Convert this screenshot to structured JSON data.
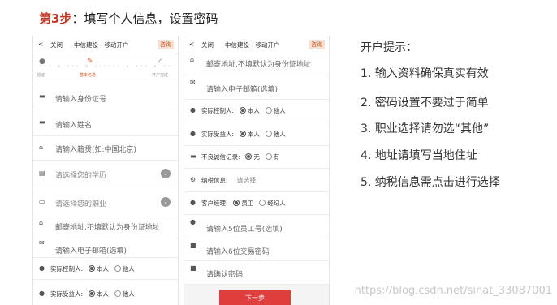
{
  "step_title": {
    "prefix": "第3步",
    "rest": "：填写个人信息，设置密码"
  },
  "phone1": {
    "topbar": {
      "back_icon": "chevron-left-icon",
      "close": "关闭",
      "title": "中信建投 - 移动开户",
      "badge": "咨询"
    },
    "steps": {
      "first": "验证",
      "active": "基本信息",
      "last": "开户完成"
    },
    "rows": [
      {
        "icon": "id-card-icon",
        "text": "请输入身份证号"
      },
      {
        "icon": "id-card-icon",
        "text": "请输入姓名"
      },
      {
        "icon": "home-icon",
        "text": "请输入籍贯(如:中国北京)"
      },
      {
        "icon": "book-icon",
        "text": "请选择您的学历"
      },
      {
        "icon": "briefcase-icon",
        "text": "请选择您的职业"
      },
      {
        "icon": "home-icon",
        "text": "邮寄地址,不填默认为身份证地址"
      },
      {
        "icon": "mail-icon",
        "text": "请输入电子邮箱(选填)"
      },
      {
        "icon": "user-icon",
        "label": "实际控制人:",
        "options": [
          "本人",
          "他人"
        ]
      },
      {
        "icon": "user-icon",
        "label": "实际受益人:",
        "options": [
          "本人",
          "他人"
        ]
      }
    ]
  },
  "phone2": {
    "topbar": {
      "back_icon": "chevron-left-icon",
      "close": "关闭",
      "title": "中信建投 - 移动开户",
      "badge": "咨询"
    },
    "rows": [
      {
        "icon": "home-icon",
        "text": "邮寄地址,不填默认为身份证地址"
      },
      {
        "icon": "mail-icon",
        "text": "请输入电子邮箱(选填)"
      },
      {
        "icon": "user-icon",
        "label": "实际控制人:",
        "options": [
          "本人",
          "他人"
        ]
      },
      {
        "icon": "user-icon",
        "label": "实际受益人:",
        "options": [
          "本人",
          "他人"
        ]
      },
      {
        "icon": "card-icon",
        "label": "不良诚信记录:",
        "options": [
          "无",
          "有"
        ]
      },
      {
        "icon": "settings-icon",
        "label": "纳税信息:",
        "text": "请选择"
      },
      {
        "icon": "user-icon",
        "label": "客户经理:",
        "options": [
          "员工",
          "经纪人"
        ]
      },
      {
        "icon": "user-icon",
        "text": "请输入5位员工号(选填)"
      },
      {
        "icon": "lock-icon",
        "text": "请输入6位交易密码"
      },
      {
        "icon": "lock-icon",
        "text": "请确认密码"
      }
    ],
    "next_button": "下一步"
  },
  "tips": {
    "title": "开户提示：",
    "items": [
      "1. 输入资料确保真实有效",
      "2. 密码设置不要过于简单",
      "3. 职业选择请勿选“其他”",
      "4. 地址请填写当地住址",
      "5. 纳税信息需点击进行选择"
    ]
  },
  "watermark": "https://blog.csdn.net/sinat_33087001"
}
